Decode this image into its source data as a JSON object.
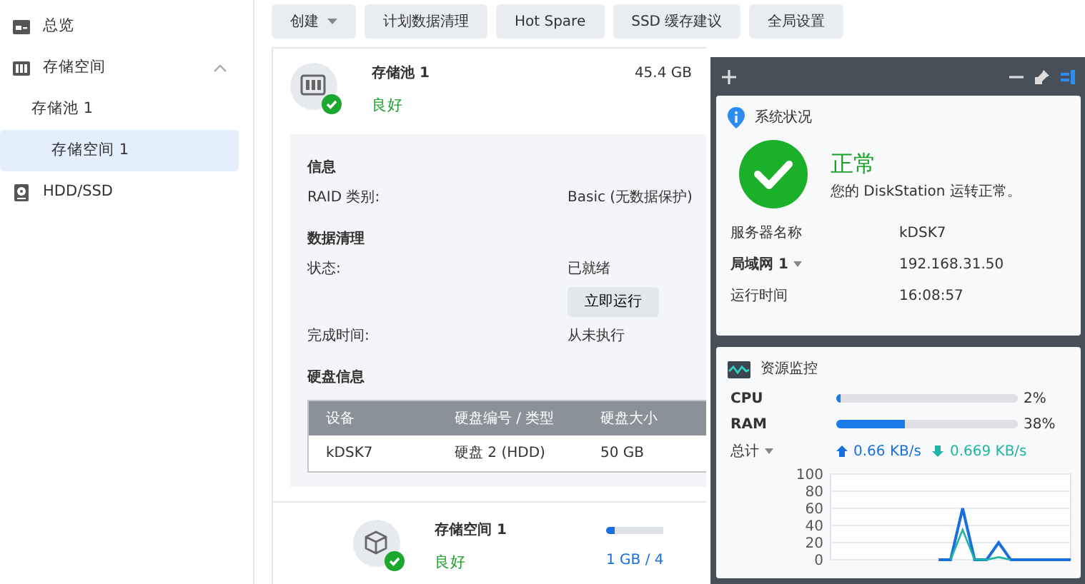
{
  "sidebar": {
    "items": [
      {
        "label": "总览",
        "kind": "overview",
        "selected": false
      },
      {
        "label": "存储空间",
        "kind": "storage",
        "selected": false,
        "expanded": true,
        "children": [
          {
            "label": "存储池 1",
            "selected": false,
            "children": [
              {
                "label": "存储空间 1",
                "selected": true
              }
            ]
          }
        ]
      },
      {
        "label": "HDD/SSD",
        "kind": "disk",
        "selected": false
      }
    ]
  },
  "toolbar": [
    {
      "label": "创建",
      "dropdown": true
    },
    {
      "label": "计划数据清理"
    },
    {
      "label": "Hot Spare"
    },
    {
      "label": "SSD 缓存建议"
    },
    {
      "label": "全局设置"
    }
  ],
  "pool": {
    "name": "存储池 1",
    "status": "良好",
    "capacity": "45.4 GB",
    "sections": [
      {
        "heading": "信息",
        "rows": [
          {
            "label": "RAID 类别:",
            "value": "Basic (无数据保护)"
          }
        ]
      },
      {
        "heading": "数据清理",
        "rows": [
          {
            "label": "状态:",
            "value": "已就绪",
            "button": "立即运行"
          },
          {
            "label": "完成时间:",
            "value": "从未执行"
          }
        ]
      }
    ],
    "disk_info": {
      "heading": "硬盘信息",
      "columns": [
        "设备",
        "硬盘编号 / 类型",
        "硬盘大小"
      ],
      "rows": [
        [
          "kDSK7",
          "硬盘 2 (HDD)",
          "50 GB"
        ]
      ]
    }
  },
  "volume": {
    "name": "存储空间 1",
    "status": "良好",
    "level": 0.02,
    "usage": "1 GB / 4"
  },
  "widget_panel": {
    "system_health": {
      "title": "系统状况",
      "status": "正常",
      "message": "您的 DiskStation 运转正常。",
      "rows": [
        {
          "label": "服务器名称",
          "value": "kDSK7"
        },
        {
          "label": "局域网 1",
          "dropdown": true,
          "value": "192.168.31.50"
        },
        {
          "label": "运行时间",
          "value": "16:08:57"
        }
      ]
    },
    "resource_monitor": {
      "title": "资源监控",
      "meters": [
        {
          "label": "CPU",
          "level": 0.02,
          "reading": "2%"
        },
        {
          "label": "RAM",
          "level": 0.38,
          "reading": "38%"
        }
      ],
      "network": {
        "label": "总计",
        "upload": "0.66 KB/s",
        "download": "0.669 KB/s"
      },
      "chart_data": {
        "type": "line",
        "grid": true,
        "ylim": [
          0,
          100
        ],
        "yticks": [
          0,
          20,
          40,
          60,
          80,
          100
        ],
        "series": [
          {
            "color": "#1a6fe0",
            "values": [
              null,
              null,
              null,
              null,
              null,
              null,
              null,
              null,
              null,
              0,
              0,
              60,
              0,
              0,
              20,
              0,
              0,
              0,
              0,
              0,
              0
            ]
          },
          {
            "color": "#1fb5a0",
            "values": [
              null,
              null,
              null,
              null,
              null,
              null,
              null,
              null,
              null,
              null,
              0,
              35,
              0,
              0,
              3,
              0,
              null,
              null,
              null,
              null,
              null
            ]
          }
        ]
      }
    }
  }
}
